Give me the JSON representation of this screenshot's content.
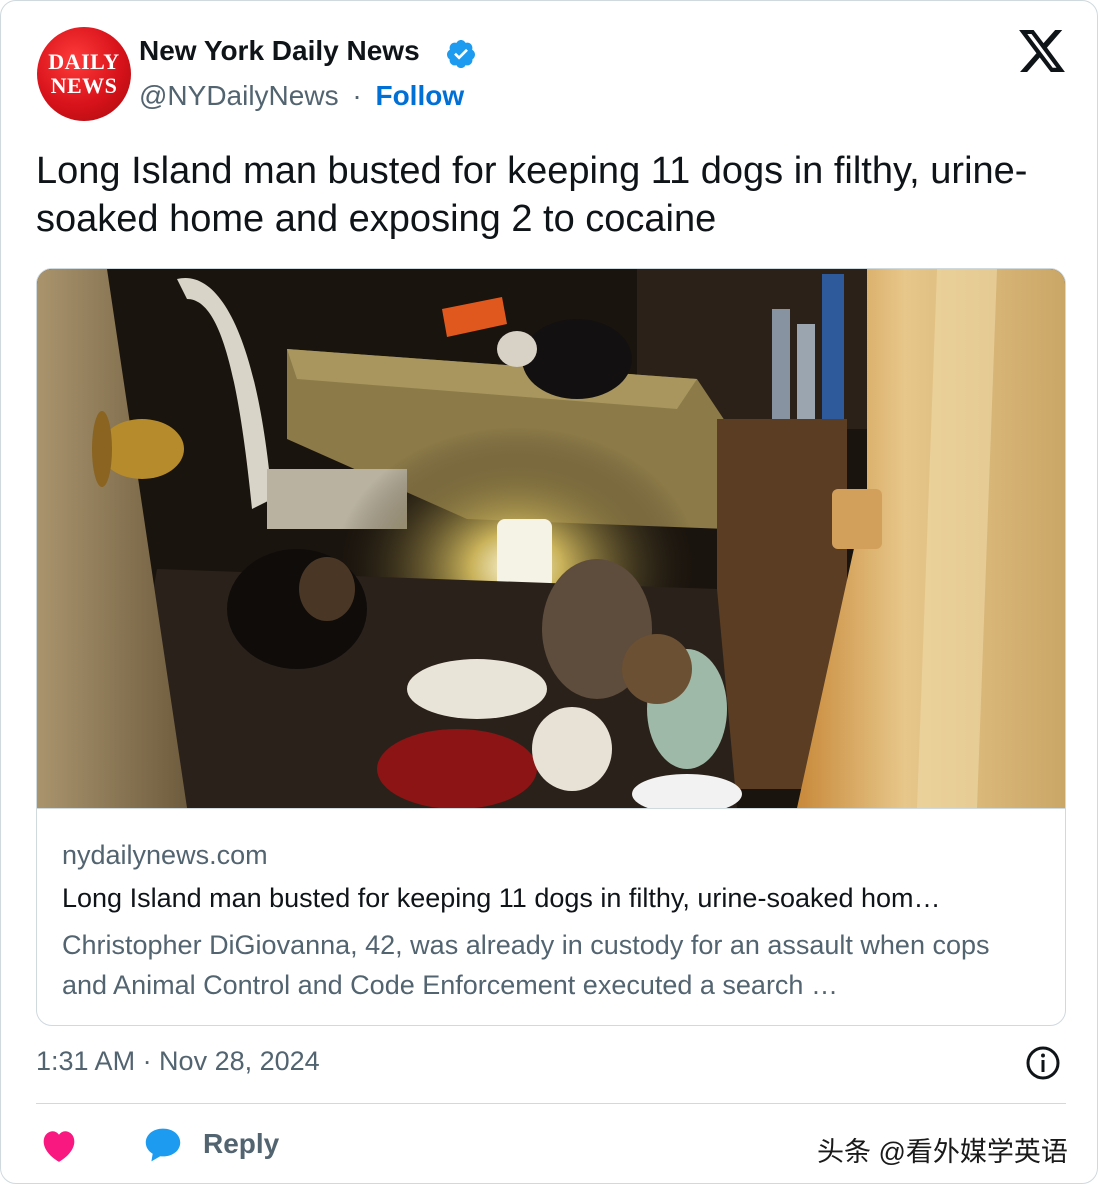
{
  "author": {
    "display_name": "New York Daily News",
    "handle": "@NYDailyNews",
    "separator": "·",
    "follow_label": "Follow",
    "avatar_lines": [
      "DAILY",
      "NEWS"
    ],
    "verified_color": "#1d9bf0"
  },
  "tweet": {
    "text": "Long Island man busted for keeping 11 dogs in filthy, urine-soaked home and exposing 2 to cocaine"
  },
  "link_card": {
    "domain": "nydailynews.com",
    "title": "Long Island man busted for keeping 11 dogs in filthy, urine-soaked hom…",
    "description": "Christopher DiGiovanna, 42, was already in custody for an assault when cops and Animal Control and Code Enforcement executed a search …",
    "image_description_icon": "photo-of-cluttered-room-with-dogs"
  },
  "meta": {
    "timestamp": "1:31 AM · Nov 28, 2024"
  },
  "actions": {
    "reply_label": "Reply",
    "heart_color": "#f91880",
    "bubble_color": "#1d9bf0"
  },
  "watermark": "头条 @看外媒学英语",
  "colors": {
    "link": "#006fd6",
    "secondary_text": "#536471",
    "brand_red": "#d8121a"
  }
}
